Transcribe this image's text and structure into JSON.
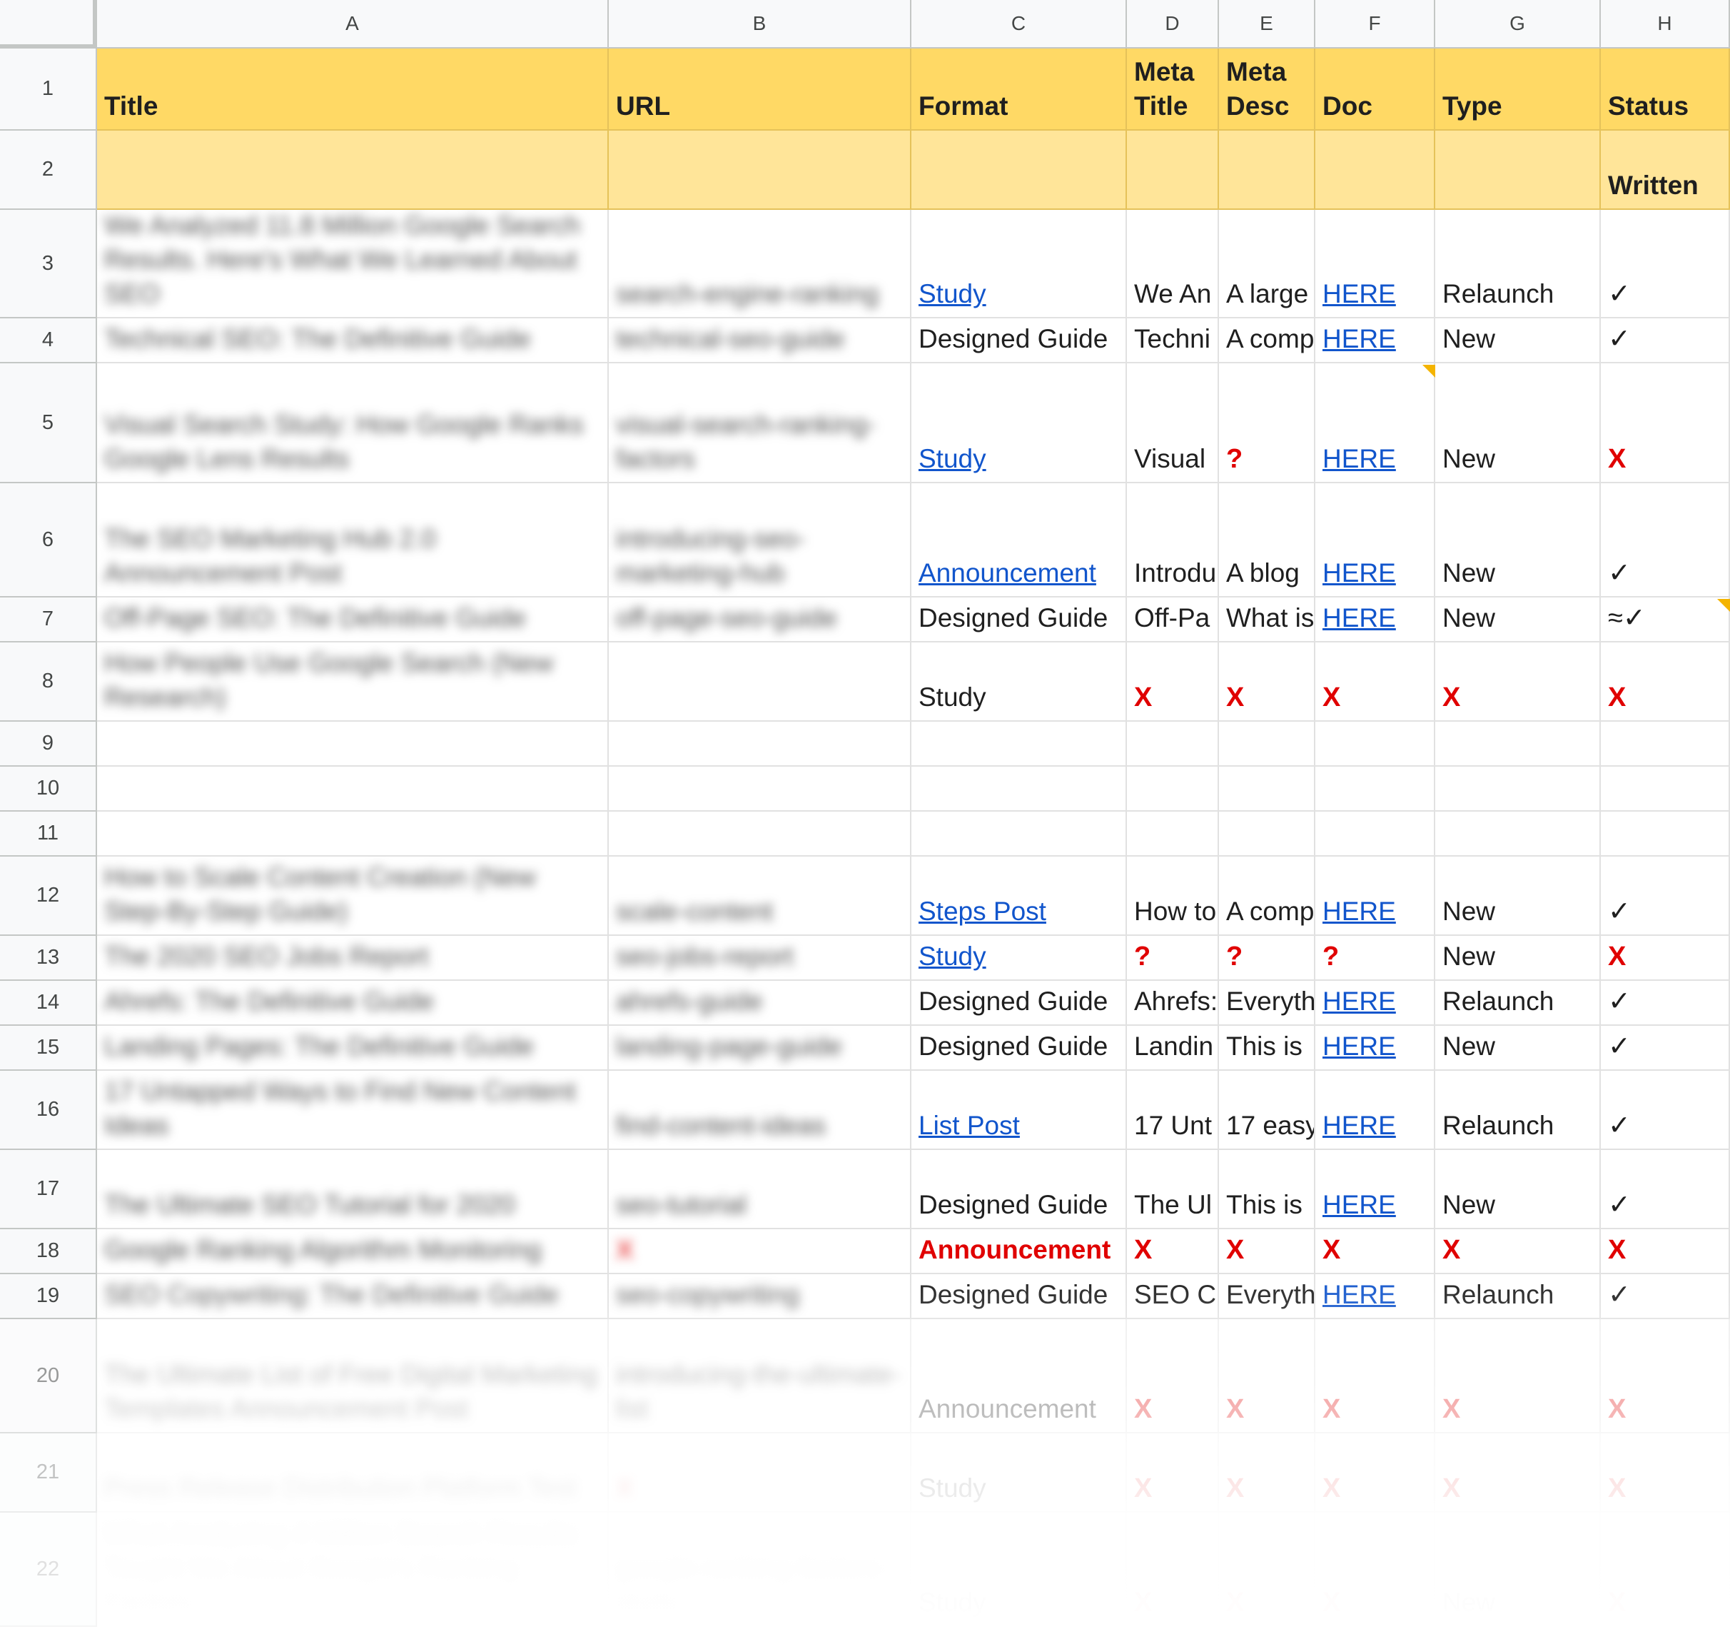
{
  "columns": [
    "A",
    "B",
    "C",
    "D",
    "E",
    "F",
    "G",
    "H"
  ],
  "header": {
    "row_num": "1",
    "title": "Title",
    "url": "URL",
    "format": "Format",
    "meta_title": "Meta\nTitle",
    "meta_desc": "Meta\nDesc",
    "doc": "Doc",
    "type": "Type",
    "status": "Status"
  },
  "subheader": {
    "row_num": "2",
    "status": "Written"
  },
  "rows": [
    {
      "num": "3",
      "title": "We Analyzed 11.8 Million Google Search Results. Here's What We Learned About SEO",
      "url": "search-engine-ranking",
      "format": "Study",
      "format_style": "link",
      "meta_title": "We An",
      "meta_desc": "A large",
      "doc": "HERE",
      "type": "Relaunch",
      "status": "✓"
    },
    {
      "num": "4",
      "title": "Technical SEO: The Definitive Guide",
      "url": "technical-seo-guide",
      "format": "Designed Guide",
      "format_style": "plain",
      "meta_title": "Techni",
      "meta_desc": "A comp",
      "doc": "HERE",
      "type": "New",
      "status": "✓"
    },
    {
      "num": "5",
      "title": "Visual Search Study: How Google Ranks Google Lens Results",
      "url": "visual-search-ranking-factors",
      "format": "Study",
      "format_style": "link",
      "meta_title": "Visual",
      "meta_desc": "?",
      "doc": "HERE",
      "type": "New",
      "status": "X"
    },
    {
      "num": "6",
      "title": "The SEO Marketing Hub 2.0 Announcement Post",
      "url": "introducing-seo-marketing-hub",
      "format": "Announcement",
      "format_style": "link",
      "meta_title": "Introdu",
      "meta_desc": "A blog",
      "doc": "HERE",
      "type": "New",
      "status": "✓"
    },
    {
      "num": "7",
      "title": "Off-Page SEO: The Definitive Guide",
      "url": "off-page-seo-guide",
      "format": "Designed Guide",
      "format_style": "plain",
      "meta_title": "Off-Pa",
      "meta_desc": "What is",
      "doc": "HERE",
      "type": "New",
      "status": "≈✓"
    },
    {
      "num": "8",
      "title": "How People Use Google Search (New Research)",
      "url": "",
      "format": "Study",
      "format_style": "plain",
      "meta_title": "X",
      "meta_desc": "X",
      "doc": "X",
      "type": "X",
      "status": "X"
    },
    {
      "num": "9"
    },
    {
      "num": "10"
    },
    {
      "num": "11"
    },
    {
      "num": "12",
      "title": "How to Scale Content Creation (New Step-By-Step Guide)",
      "url": "scale-content",
      "format": "Steps Post",
      "format_style": "link",
      "meta_title": "How to",
      "meta_desc": "A comp",
      "doc": "HERE",
      "type": "New",
      "status": "✓"
    },
    {
      "num": "13",
      "title": "The 2020 SEO Jobs Report",
      "url": "seo-jobs-report",
      "format": "Study",
      "format_style": "link",
      "meta_title": "?",
      "meta_desc": "?",
      "doc": "?",
      "type": "New",
      "status": "X"
    },
    {
      "num": "14",
      "title": "Ahrefs: The Definitive Guide",
      "url": "ahrefs-guide",
      "format": "Designed Guide",
      "format_style": "plain",
      "meta_title": "Ahrefs:",
      "meta_desc": "Everyth",
      "doc": "HERE",
      "type": "Relaunch",
      "status": "✓"
    },
    {
      "num": "15",
      "title": "Landing Pages: The Definitive Guide",
      "url": "landing-page-guide",
      "format": "Designed Guide",
      "format_style": "plain",
      "meta_title": "Landin",
      "meta_desc": "This is",
      "doc": "HERE",
      "type": "New",
      "status": "✓"
    },
    {
      "num": "16",
      "title": "17 Untapped Ways to Find New Content Ideas",
      "url": "find-content-ideas",
      "format": "List Post",
      "format_style": "link",
      "meta_title": "17 Unt",
      "meta_desc": "17 easy",
      "doc": "HERE",
      "type": "Relaunch",
      "status": "✓"
    },
    {
      "num": "17",
      "title": "The Ultimate SEO Tutorial for 2020",
      "url": "seo-tutorial",
      "format": "Designed Guide",
      "format_style": "plain",
      "meta_title": "The Ul",
      "meta_desc": "This is",
      "doc": "HERE",
      "type": "New",
      "status": "✓"
    },
    {
      "num": "18",
      "title": "Google Ranking Algorithm Monitoring",
      "url": "X",
      "format": "Announcement",
      "format_style": "red",
      "meta_title": "X",
      "meta_desc": "X",
      "doc": "X",
      "type": "X",
      "status": "X"
    },
    {
      "num": "19",
      "title": "SEO Copywriting: The Definitive Guide",
      "url": "seo-copywriting",
      "format": "Designed Guide",
      "format_style": "plain",
      "meta_title": "SEO C",
      "meta_desc": "Everyth",
      "doc": "HERE",
      "type": "Relaunch",
      "status": "✓"
    },
    {
      "num": "20",
      "title": "The Ultimate List of Free Digital Marketing Templates Announcement Post",
      "url": "introducing-the-ultimate-list",
      "format": "Announcement",
      "format_style": "plain",
      "meta_title": "X",
      "meta_desc": "X",
      "doc": "X",
      "type": "X",
      "status": "X"
    },
    {
      "num": "21",
      "title": "Press Release Distribution Platform Test",
      "url": "X",
      "format": "Study",
      "format_style": "plain",
      "meta_title": "X",
      "meta_desc": "X",
      "doc": "X",
      "type": "X",
      "status": "X"
    },
    {
      "num": "22",
      "title": "What Analyzing 4 Million Search Results Taught Me About Google's Ranking Factors",
      "url": "google-ranking-factors-study",
      "format": "Study",
      "format_style": "plain",
      "meta_title": "X",
      "meta_desc": "X",
      "doc": "X",
      "type": "New",
      "status": "X"
    }
  ],
  "colors": {
    "header_bg": "#ffd965",
    "subheader_bg": "#ffe599",
    "link": "#1155cc",
    "error_red": "#e00000",
    "note_marker": "#f4b400"
  }
}
